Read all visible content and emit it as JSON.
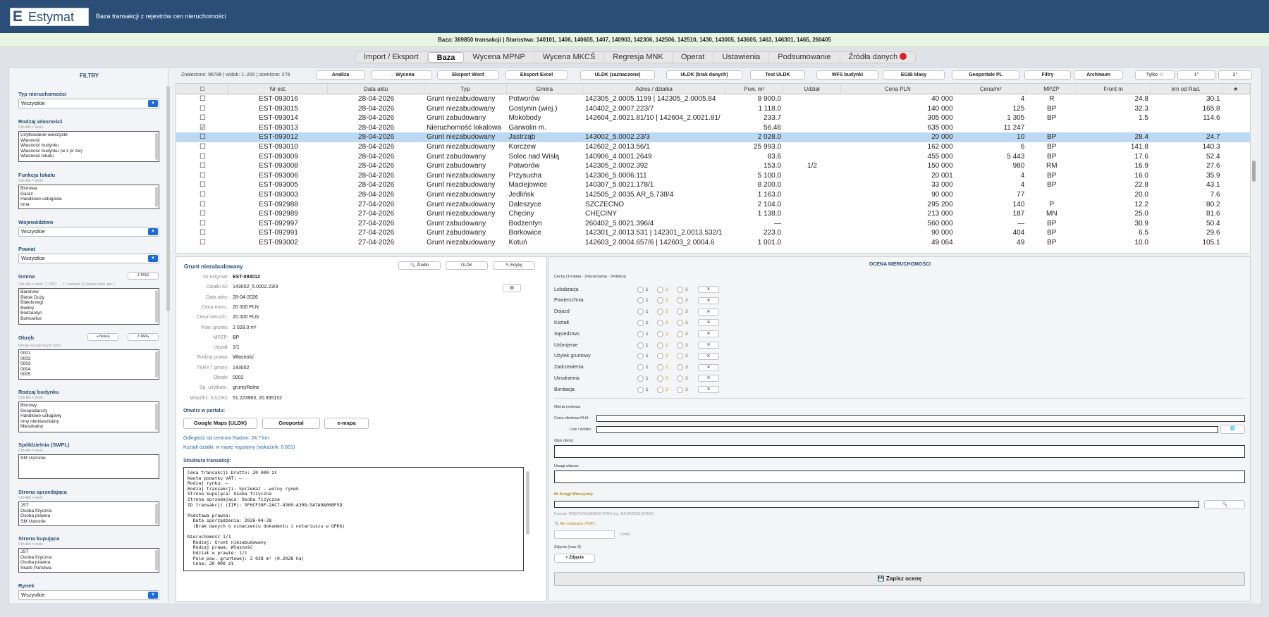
{
  "app": {
    "logo_mark": "E",
    "logo_text": "Estymat",
    "subtitle": "Baza transakcji z rejestrów cen nieruchomości"
  },
  "infobar": "Baza: 369850 transakcji  |  Starostwa: 140101, 1406, 140605, 1407, 140903, 142306, 142506, 142510, 1430, 143005, 143605, 1463, 146301, 1465, 260405",
  "tabs": [
    "Import / Eksport",
    "Baza",
    "Wycena MPNP",
    "Wycena MKCŚ",
    "Regresja MNK",
    "Operat",
    "Ustawienia",
    "Podsumowanie",
    "Źródła danych"
  ],
  "filters": {
    "title": "FILTRY",
    "typ": {
      "label": "Typ nieruchomości",
      "value": "Wszystkie"
    },
    "rodzaj": {
      "label": "Rodzaj własności",
      "hint": "Ctrl+klik = wiele",
      "items": [
        "Użytkowanie wieczyste",
        "Własność",
        "Własność budynku",
        "Własność budynku (w z pr zw)",
        "Własność lokalu"
      ]
    },
    "funkcja": {
      "label": "Funkcja lokalu",
      "hint": "Ctrl+klik = wiele",
      "items": [
        "Biurowa",
        "Garaż",
        "Handlowo-usługowa",
        "Inna"
      ]
    },
    "woj": {
      "label": "Województwo",
      "value": "Wszystkie"
    },
    "powiat": {
      "label": "Powiat",
      "value": "Wszystkie"
    },
    "gmina": {
      "label": "Gmina",
      "btn": "Z PRG",
      "hint": "Ctrl+klik = wiele  \"Z PRG\" → 17 zamiast 13 (należy tylko 'gm.')",
      "items": [
        "Baranów",
        "Bielsk Duży",
        "Białobrzegi",
        "Bieliny",
        "Bodzentyn",
        "Borkowice"
      ]
    },
    "obreb": {
      "label": "Obręb",
      "btn1": "+ Nolea",
      "btn2": "Z PRG",
      "hint": "Filtruje wg wybranych gmin",
      "items": [
        "0001",
        "0002",
        "0003",
        "0004",
        "0005"
      ]
    },
    "budynek": {
      "label": "Rodzaj budynku",
      "hint": "Ctrl+klik = wiele",
      "items": [
        "Biurowy",
        "Gospodarczy",
        "Handlowo-usługowy",
        "Inny niemieszkalny",
        "Mieszkalny"
      ]
    },
    "swpl": {
      "label": "Spółdzielnia (SWPL)",
      "hint": "Ctrl+klik = wiele",
      "items": [
        "SM Ustronie"
      ]
    },
    "sprzedajaca": {
      "label": "Strona sprzedająca",
      "hint": "Ctrl+klik = wiele",
      "items": [
        "JST",
        "Osoba fizyczna",
        "Osoba prawna",
        "SM Ustronie"
      ]
    },
    "kupujaca": {
      "label": "Strona kupująca",
      "hint": "Ctrl+klik = wiele",
      "items": [
        "JST",
        "Osoba fizyczna",
        "Osoba prawna",
        "Skarb Państwa"
      ]
    },
    "rynek": {
      "label": "Rynek",
      "value": "Wszystkie"
    }
  },
  "toolbar": {
    "status": "Znaleziono: 96788  |  widok: 1–200  |  ocenione: 278",
    "buttons": [
      "Analiza",
      "→ Wycena",
      "Eksport Word",
      "Eksport Excel",
      "ULDK (zaznaczone)",
      "ULDK (brak danych)",
      "Test ULDK",
      "WFS budynki",
      "EGiB klasy",
      "Geoportale PL",
      "Filtry",
      "Archiwum",
      "Tylko ☆",
      "1°",
      "2°"
    ]
  },
  "table": {
    "headers": [
      "☐",
      "Nr est.",
      "Data aktu",
      "Typ",
      "Gmina",
      "Adres / działka",
      "Pow. m²",
      "Udział",
      "Cena PLN",
      "Cena/m²",
      "MPZP",
      "Front m",
      "km od Rad.",
      "★"
    ],
    "rows": [
      [
        "☐",
        "EST-093016",
        "28-04-2026",
        "Grunt niezabudowany",
        "Potworów",
        "142305_2.0005.1199 | 142305_2.0005.84",
        "8 900.0",
        "",
        "40 000",
        "4",
        "R",
        "24.8",
        "30.1",
        ""
      ],
      [
        "☐",
        "EST-093015",
        "28-04-2026",
        "Grunt niezabudowany",
        "Gostynin (wiej.)",
        "140402_2.0007.223/7",
        "1 118.0",
        "",
        "140 000",
        "125",
        "BP",
        "32.3",
        "165.8",
        ""
      ],
      [
        "☐",
        "EST-093014",
        "28-04-2026",
        "Grunt zabudowany",
        "Mokobody",
        "142604_2.0021.81/10 | 142604_2.0021.81/",
        "233.7",
        "",
        "305 000",
        "1 305",
        "BP",
        "1.5",
        "114.6",
        ""
      ],
      [
        "☑",
        "EST-093013",
        "28-04-2026",
        "Nieruchomość lokalowa",
        "Garwolin m.",
        "",
        "56.46",
        "",
        "635 000",
        "11 247",
        "",
        "",
        "",
        ""
      ],
      [
        "☐",
        "EST-093012",
        "28-04-2026",
        "Grunt niezabudowany",
        "Jastrząb",
        "143002_5.0002.23/3",
        "2 028.0",
        "",
        "20 000",
        "10",
        "BP",
        "28.4",
        "24.7",
        ""
      ],
      [
        "☐",
        "EST-093010",
        "28-04-2026",
        "Grunt niezabudowany",
        "Korczew",
        "142602_2.0013.56/1",
        "25 993.0",
        "",
        "162 000",
        "6",
        "BP",
        "141.8",
        "140.3",
        ""
      ],
      [
        "☐",
        "EST-093009",
        "28-04-2026",
        "Grunt zabudowany",
        "Solec nad Wisłą",
        "140906_4.0001.2649",
        "83.6",
        "",
        "455 000",
        "5 443",
        "BP",
        "17.6",
        "52.4",
        ""
      ],
      [
        "☐",
        "EST-093008",
        "28-04-2026",
        "Grunt zabudowany",
        "Potworów",
        "142305_2.0002.392",
        "153.0",
        "1/2",
        "150 000",
        "980",
        "RM",
        "16.9",
        "27.6",
        ""
      ],
      [
        "☐",
        "EST-093006",
        "28-04-2026",
        "Grunt niezabudowany",
        "Przysucha",
        "142306_5.0006.111",
        "5 100.0",
        "",
        "20 001",
        "4",
        "BP",
        "16.0",
        "35.9",
        ""
      ],
      [
        "☐",
        "EST-093005",
        "28-04-2026",
        "Grunt niezabudowany",
        "Maciejowice",
        "140307_5.0021.178/1",
        "8 200.0",
        "",
        "33 000",
        "4",
        "BP",
        "22.8",
        "43.1",
        ""
      ],
      [
        "☐",
        "EST-093003",
        "28-04-2026",
        "Grunt niezabudowany",
        "Jedlińsk",
        "142505_2.0035.AR_5.738/4",
        "1 163.0",
        "",
        "90 000",
        "77",
        "",
        "20.0",
        "7.6",
        ""
      ],
      [
        "☐",
        "EST-092988",
        "27-04-2026",
        "Grunt niezabudowany",
        "Daleszyce",
        "SZCZECNO",
        "2 104.0",
        "",
        "295 200",
        "140",
        "P",
        "12.2",
        "80.2",
        ""
      ],
      [
        "☐",
        "EST-092989",
        "27-04-2026",
        "Grunt niezabudowany",
        "Chęciny",
        "CHĘCINY",
        "1 138.0",
        "",
        "213 000",
        "187",
        "MN",
        "25.0",
        "81.6",
        ""
      ],
      [
        "☐",
        "EST-092997",
        "27-04-2026",
        "Grunt zabudowany",
        "Bodzentyn",
        "260402_5.0021.396/4",
        "—",
        "",
        "560 000",
        "—",
        "BP",
        "30.9",
        "50.4",
        ""
      ],
      [
        "☐",
        "EST-092991",
        "27-04-2026",
        "Grunt zabudowany",
        "Borkowice",
        "142301_2.0013.531 | 142301_2.0013.532/1",
        "223.0",
        "",
        "90 000",
        "404",
        "BP",
        "6.5",
        "29.6",
        ""
      ],
      [
        "☐",
        "EST-093002",
        "27-04-2026",
        "Grunt niezabudowany",
        "Kotuń",
        "142603_2.0004.657/6 | 142603_2.0004.6",
        "1 001.0",
        "",
        "49 064",
        "49",
        "BP",
        "10.0",
        "105.1",
        ""
      ]
    ],
    "selected_index": 4
  },
  "detail": {
    "title": "Grunt niezabudowany",
    "btn_zrodlo": "Źródło",
    "btn_uldk": "ULDK",
    "btn_edytuj": "Edytuj",
    "fields": [
      [
        "Nr estymat:",
        "EST-093012"
      ],
      [
        "Działki ID:",
        "143002_5.0002.23/3"
      ],
      [
        "Data aktu:",
        "28-04-2026"
      ],
      [
        "Cena trans.:",
        "20 000 PLN"
      ],
      [
        "Cena nieruch.:",
        "20 000 PLN"
      ],
      [
        "Pow. gruntu:",
        "2 028.0 m²"
      ],
      [
        "MPZP:",
        "BP"
      ],
      [
        "Udział:",
        "1/1"
      ],
      [
        "Rodzaj prawa:",
        "Własność"
      ],
      [
        "TERYT gminy:",
        "143002"
      ],
      [
        "Obręb:",
        "0002"
      ],
      [
        "Sp. użytkow.:",
        "gruntyRolne"
      ],
      [
        "Współrz. (ULDK):",
        "51.223983, 20.935152"
      ]
    ],
    "open_portal": "Otwórz w portalu:",
    "portals": [
      "Google Maps (ULDK)",
      "Geoportal",
      "e-mapa"
    ],
    "note1": "Odległość od centrum Radom: 24.7 km",
    "note2": "Kształt działki: w miarę regularny (wskaźnik: 0.601)",
    "struct_label": "Struktura transakcji:",
    "struct_text": "Cena transakcji brutto: 20 000 zł\nKwota podatku VAT: –\nRodzaj rynku: –\nRodzaj transakcji: Sprzedaż – wolny rynek\nStrona kupująca: Osoba fizyczna\nStrona sprzedająca: Osoba fizyczna\nID transakcji (IIP): 5F0CF38F-2AC7-4360-A308-5A7A9A008F5D\n\nPodstawa prawna:\n  Data sporządzenia: 2026-04-28\n  (Brak danych o oznaczeniu dokumentu i notariuszu w GPKG)\n\nNieruchomość 1/1\n  Rodzaj: Grunt niezabudowany\n  Rodzaj prawa: Własność\n  Udział w prawie: 1/1\n  Pole pow. gruntowej: 2 028 m² (0.2028 ha)\n  Cena: 20 000 zł"
  },
  "rating": {
    "title": "OCENA NIERUCHOMOŚCI",
    "legend": "Cechy  (1=słaba · 2=przeciętna · 3=dobra)",
    "features": [
      "Lokalizacja",
      "Powierzchnia",
      "Dojazd",
      "Kształt",
      "Sąsiedztwo",
      "Uzbrojenie",
      "Użytek gruntowy",
      "Zadrzewienia",
      "Utrudnienia",
      "Bonitacja"
    ],
    "opts": [
      "1",
      "2",
      "3"
    ],
    "clear": "✕",
    "offer_label": "Oferta rynkowa",
    "offer_price": "Cena ofertowa PLN:",
    "link": "Link / źródło:",
    "opis": "Opis oferty:",
    "uwagi": "Uwagi własne:",
    "kw_label": "Nr Księgi Wieczystej:",
    "kw_hint": "Format: PREFIX/NUMER/CYFRA (np. RA1R/00012345/6)",
    "akt": "Akt notarialny (PDF):",
    "akt_status": "(brak)",
    "photos": "Zdjęcia (max 3)",
    "add_photo": "+ Zdjęcie",
    "save": "Zapisz ocenę"
  }
}
